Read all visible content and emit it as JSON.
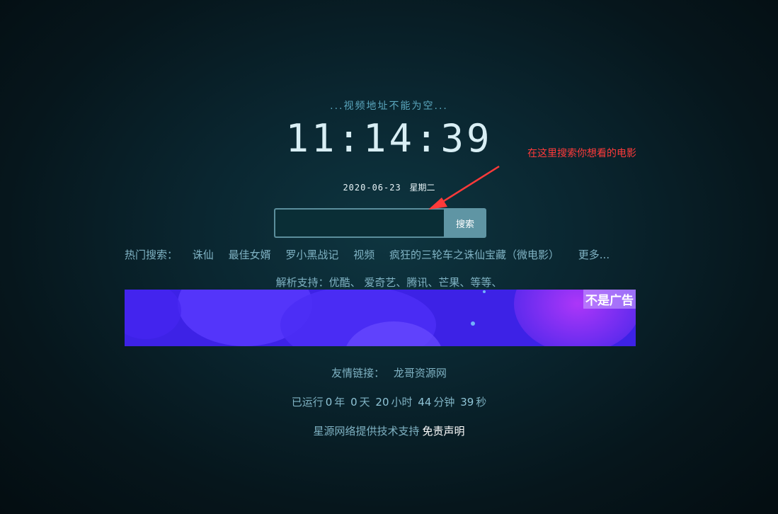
{
  "status_text": "...视频地址不能为空...",
  "clock": {
    "time": "11:14:39"
  },
  "date": {
    "value": "2020-06-23",
    "weekday": "星期二"
  },
  "search": {
    "value": "",
    "placeholder": "",
    "button_label": "搜索"
  },
  "annotation": {
    "text": "在这里搜索你想看的电影",
    "color": "#ff3a3a"
  },
  "hot_search": {
    "label": "热门搜索：",
    "items": [
      "诛仙",
      "最佳女婿",
      "罗小黑战记",
      "视频",
      "疯狂的三轮车之诛仙宝藏（微电影）"
    ],
    "more": "更多..."
  },
  "parse_support": "解析支持：优酷、 爱奇艺、腾讯、芒果、等等、",
  "banner": {
    "tag": "不是广告"
  },
  "friend_links": {
    "label": "友情链接：",
    "items": [
      "龙哥资源网"
    ]
  },
  "runtime": {
    "prefix": "已运行",
    "years": "0",
    "years_unit": "年",
    "days": "0",
    "days_unit": "天",
    "hours": "20",
    "hours_unit": "小时",
    "minutes": "44",
    "minutes_unit": "分钟",
    "seconds": "39",
    "seconds_unit": "秒"
  },
  "footer": {
    "text": "星源网络提供技术支持",
    "disclaimer": "免责声明"
  },
  "colors": {
    "background": "#0a2630",
    "accent": "#5f95a4",
    "text": "#7fb2c3",
    "banner": "#3b1fe8"
  }
}
